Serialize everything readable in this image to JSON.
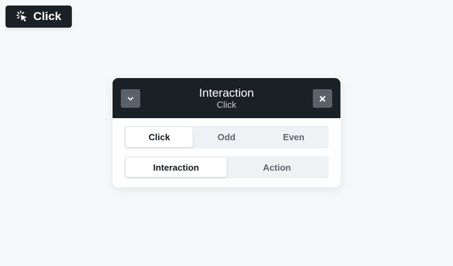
{
  "chip": {
    "label": "Click",
    "icon": "click-icon"
  },
  "panel": {
    "title": "Interaction",
    "subtitle": "Click",
    "collapse_icon": "chevron-down-icon",
    "close_icon": "close-icon",
    "row1": {
      "options": [
        "Click",
        "Odd",
        "Even"
      ],
      "selected": "Click"
    },
    "row2": {
      "options": [
        "Interaction",
        "Action"
      ],
      "selected": "Interaction"
    }
  },
  "colors": {
    "dark": "#1b2026",
    "header_button": "#5b6168",
    "background": "#f7f8fa",
    "segment_track": "#eff1f4"
  }
}
